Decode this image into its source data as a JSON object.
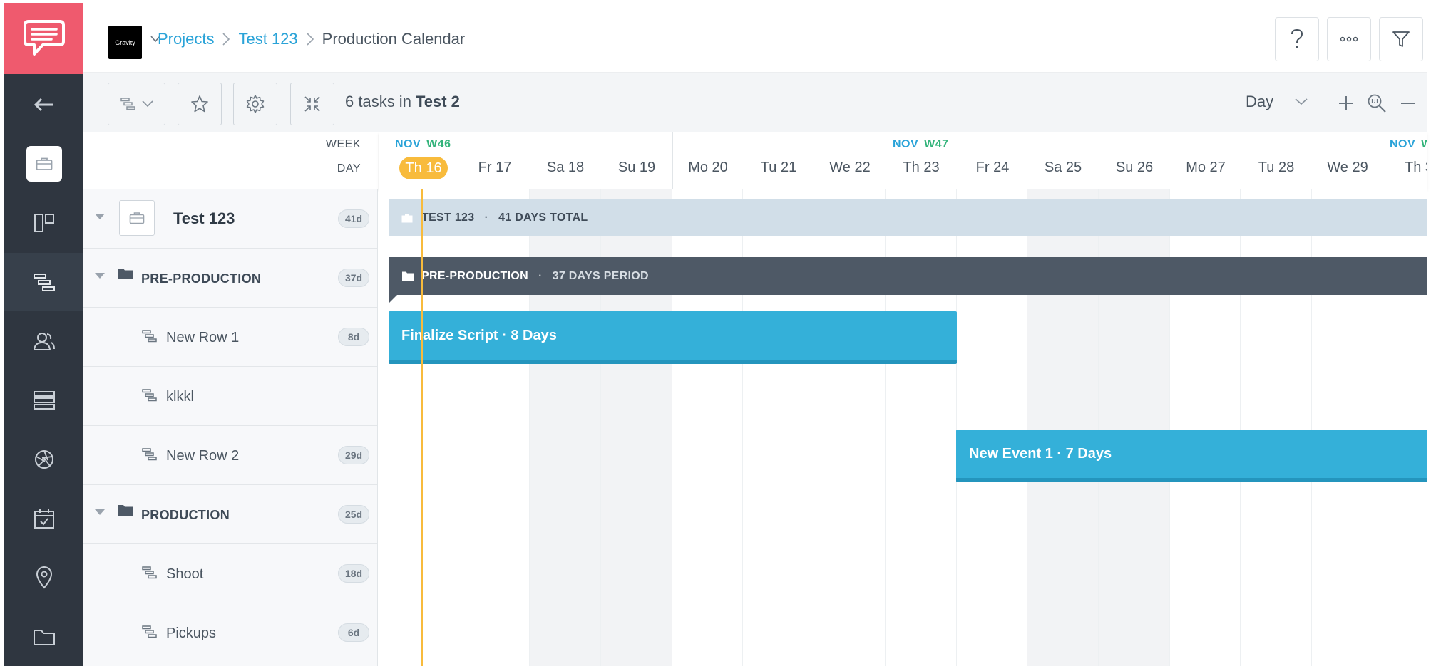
{
  "header": {
    "org_logo_text": "Gravity",
    "breadcrumbs": [
      "Projects",
      "Test 123",
      "Production Calendar"
    ]
  },
  "toolbar": {
    "task_count_prefix": "6 tasks in",
    "task_count_project": "Test 2",
    "zoom_level": "Day"
  },
  "tree": {
    "header_week": "WEEK",
    "header_day": "DAY",
    "root": {
      "title": "Test 123",
      "duration": "41d"
    },
    "rows": [
      {
        "kind": "group",
        "title": "PRE-PRODUCTION",
        "duration": "37d"
      },
      {
        "kind": "task",
        "title": "New Row 1",
        "duration": "8d"
      },
      {
        "kind": "task",
        "title": "klkkl",
        "duration": ""
      },
      {
        "kind": "task",
        "title": "New Row 2",
        "duration": "29d"
      },
      {
        "kind": "group",
        "title": "PRODUCTION",
        "duration": "25d"
      },
      {
        "kind": "task",
        "title": "Shoot",
        "duration": "18d"
      },
      {
        "kind": "task",
        "title": "Pickups",
        "duration": "6d"
      }
    ]
  },
  "timeline": {
    "weeks": [
      {
        "month": "NOV",
        "week": "W46"
      },
      {
        "month": "NOV",
        "week": "W47"
      },
      {
        "month": "NOV",
        "week": "W"
      }
    ],
    "days": [
      "Th 16",
      "Fr 17",
      "Sa 18",
      "Su 19",
      "Mo 20",
      "Tu 21",
      "We 22",
      "Th 23",
      "Fr 24",
      "Sa 25",
      "Su 26",
      "Mo 27",
      "Tu 28",
      "We 29",
      "Th 3"
    ],
    "today": "Th 16",
    "project_bar": {
      "title": "TEST 123",
      "detail": "41 DAYS TOTAL"
    },
    "group_bar": {
      "title": "PRE-PRODUCTION",
      "detail": "37 DAYS PERIOD"
    },
    "tasks": [
      {
        "label": "Finalize Script · 8 Days"
      },
      {
        "label": "New Event 1 · 7 Days"
      }
    ]
  },
  "colors": {
    "brand": "#ef5a6e",
    "sidebar": "#2f3640",
    "link": "#2aa3d8",
    "today": "#f8bb3c",
    "task": "#34b0d9",
    "group_bar": "#4e5966",
    "project_bar": "#d1dee8"
  }
}
